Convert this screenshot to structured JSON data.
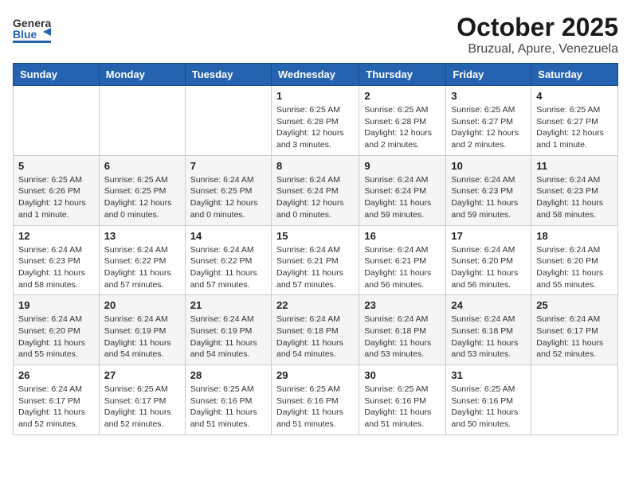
{
  "header": {
    "logo_general": "General",
    "logo_blue": "Blue",
    "month": "October 2025",
    "location": "Bruzual, Apure, Venezuela"
  },
  "weekdays": [
    "Sunday",
    "Monday",
    "Tuesday",
    "Wednesday",
    "Thursday",
    "Friday",
    "Saturday"
  ],
  "weeks": [
    [
      {
        "day": "",
        "detail": ""
      },
      {
        "day": "",
        "detail": ""
      },
      {
        "day": "",
        "detail": ""
      },
      {
        "day": "1",
        "detail": "Sunrise: 6:25 AM\nSunset: 6:28 PM\nDaylight: 12 hours and 3 minutes."
      },
      {
        "day": "2",
        "detail": "Sunrise: 6:25 AM\nSunset: 6:28 PM\nDaylight: 12 hours and 2 minutes."
      },
      {
        "day": "3",
        "detail": "Sunrise: 6:25 AM\nSunset: 6:27 PM\nDaylight: 12 hours and 2 minutes."
      },
      {
        "day": "4",
        "detail": "Sunrise: 6:25 AM\nSunset: 6:27 PM\nDaylight: 12 hours and 1 minute."
      }
    ],
    [
      {
        "day": "5",
        "detail": "Sunrise: 6:25 AM\nSunset: 6:26 PM\nDaylight: 12 hours and 1 minute."
      },
      {
        "day": "6",
        "detail": "Sunrise: 6:25 AM\nSunset: 6:25 PM\nDaylight: 12 hours and 0 minutes."
      },
      {
        "day": "7",
        "detail": "Sunrise: 6:24 AM\nSunset: 6:25 PM\nDaylight: 12 hours and 0 minutes."
      },
      {
        "day": "8",
        "detail": "Sunrise: 6:24 AM\nSunset: 6:24 PM\nDaylight: 12 hours and 0 minutes."
      },
      {
        "day": "9",
        "detail": "Sunrise: 6:24 AM\nSunset: 6:24 PM\nDaylight: 11 hours and 59 minutes."
      },
      {
        "day": "10",
        "detail": "Sunrise: 6:24 AM\nSunset: 6:23 PM\nDaylight: 11 hours and 59 minutes."
      },
      {
        "day": "11",
        "detail": "Sunrise: 6:24 AM\nSunset: 6:23 PM\nDaylight: 11 hours and 58 minutes."
      }
    ],
    [
      {
        "day": "12",
        "detail": "Sunrise: 6:24 AM\nSunset: 6:23 PM\nDaylight: 11 hours and 58 minutes."
      },
      {
        "day": "13",
        "detail": "Sunrise: 6:24 AM\nSunset: 6:22 PM\nDaylight: 11 hours and 57 minutes."
      },
      {
        "day": "14",
        "detail": "Sunrise: 6:24 AM\nSunset: 6:22 PM\nDaylight: 11 hours and 57 minutes."
      },
      {
        "day": "15",
        "detail": "Sunrise: 6:24 AM\nSunset: 6:21 PM\nDaylight: 11 hours and 57 minutes."
      },
      {
        "day": "16",
        "detail": "Sunrise: 6:24 AM\nSunset: 6:21 PM\nDaylight: 11 hours and 56 minutes."
      },
      {
        "day": "17",
        "detail": "Sunrise: 6:24 AM\nSunset: 6:20 PM\nDaylight: 11 hours and 56 minutes."
      },
      {
        "day": "18",
        "detail": "Sunrise: 6:24 AM\nSunset: 6:20 PM\nDaylight: 11 hours and 55 minutes."
      }
    ],
    [
      {
        "day": "19",
        "detail": "Sunrise: 6:24 AM\nSunset: 6:20 PM\nDaylight: 11 hours and 55 minutes."
      },
      {
        "day": "20",
        "detail": "Sunrise: 6:24 AM\nSunset: 6:19 PM\nDaylight: 11 hours and 54 minutes."
      },
      {
        "day": "21",
        "detail": "Sunrise: 6:24 AM\nSunset: 6:19 PM\nDaylight: 11 hours and 54 minutes."
      },
      {
        "day": "22",
        "detail": "Sunrise: 6:24 AM\nSunset: 6:18 PM\nDaylight: 11 hours and 54 minutes."
      },
      {
        "day": "23",
        "detail": "Sunrise: 6:24 AM\nSunset: 6:18 PM\nDaylight: 11 hours and 53 minutes."
      },
      {
        "day": "24",
        "detail": "Sunrise: 6:24 AM\nSunset: 6:18 PM\nDaylight: 11 hours and 53 minutes."
      },
      {
        "day": "25",
        "detail": "Sunrise: 6:24 AM\nSunset: 6:17 PM\nDaylight: 11 hours and 52 minutes."
      }
    ],
    [
      {
        "day": "26",
        "detail": "Sunrise: 6:24 AM\nSunset: 6:17 PM\nDaylight: 11 hours and 52 minutes."
      },
      {
        "day": "27",
        "detail": "Sunrise: 6:25 AM\nSunset: 6:17 PM\nDaylight: 11 hours and 52 minutes."
      },
      {
        "day": "28",
        "detail": "Sunrise: 6:25 AM\nSunset: 6:16 PM\nDaylight: 11 hours and 51 minutes."
      },
      {
        "day": "29",
        "detail": "Sunrise: 6:25 AM\nSunset: 6:16 PM\nDaylight: 11 hours and 51 minutes."
      },
      {
        "day": "30",
        "detail": "Sunrise: 6:25 AM\nSunset: 6:16 PM\nDaylight: 11 hours and 51 minutes."
      },
      {
        "day": "31",
        "detail": "Sunrise: 6:25 AM\nSunset: 6:16 PM\nDaylight: 11 hours and 50 minutes."
      },
      {
        "day": "",
        "detail": ""
      }
    ]
  ]
}
